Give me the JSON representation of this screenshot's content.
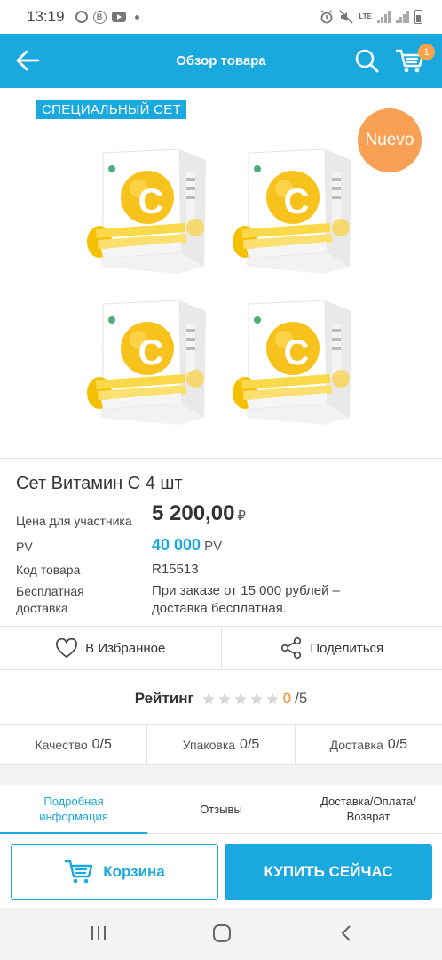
{
  "status_bar": {
    "time": "13:19",
    "network": "LTE",
    "icons": [
      "chrome-icon",
      "b-icon",
      "youtube-icon",
      "dot-icon",
      "alarm-icon",
      "mute-icon",
      "signal-icon",
      "battery-icon"
    ]
  },
  "header": {
    "title": "Обзор товара",
    "cart_count": "1",
    "accent": "#1aa9df"
  },
  "product_image": {
    "special_label": "СПЕЦИАЛЬНЫЙ СЕТ",
    "new_badge": "Nuevo",
    "box_count": 4,
    "box_letter": "C"
  },
  "product": {
    "name": "Сет Витамин С 4 шт",
    "price_label": "Цена для участника",
    "price": "5 200,00",
    "currency": "₽",
    "pv_label": "PV",
    "pv_value": "40 000",
    "pv_unit": "PV",
    "code_label": "Код товара",
    "code": "R15513",
    "delivery_label_line1": "Бесплатная",
    "delivery_label_line2": "доставка",
    "delivery_text_line1": "При заказе от 15 000 рублей –",
    "delivery_text_line2": "доставка бесплатная."
  },
  "actions": {
    "favorite": "В Избранное",
    "share": "Поделиться"
  },
  "rating": {
    "label": "Рейтинг",
    "value": "0",
    "max": "/5",
    "stars_total": 5,
    "stars_filled": 0
  },
  "sub_ratings": [
    {
      "label": "Качество",
      "value": "0/5"
    },
    {
      "label": "Упаковка",
      "value": "0/5"
    },
    {
      "label": "Доставка",
      "value": "0/5"
    }
  ],
  "tabs": [
    {
      "line1": "Подробная",
      "line2": "информация",
      "active": true
    },
    {
      "line1": "Отзывы",
      "line2": "",
      "active": false
    },
    {
      "line1": "Доставка/Оплата/",
      "line2": "Возврат",
      "active": false
    }
  ],
  "buttons": {
    "cart": "Корзина",
    "buy": "КУПИТЬ СЕЙЧАС"
  }
}
